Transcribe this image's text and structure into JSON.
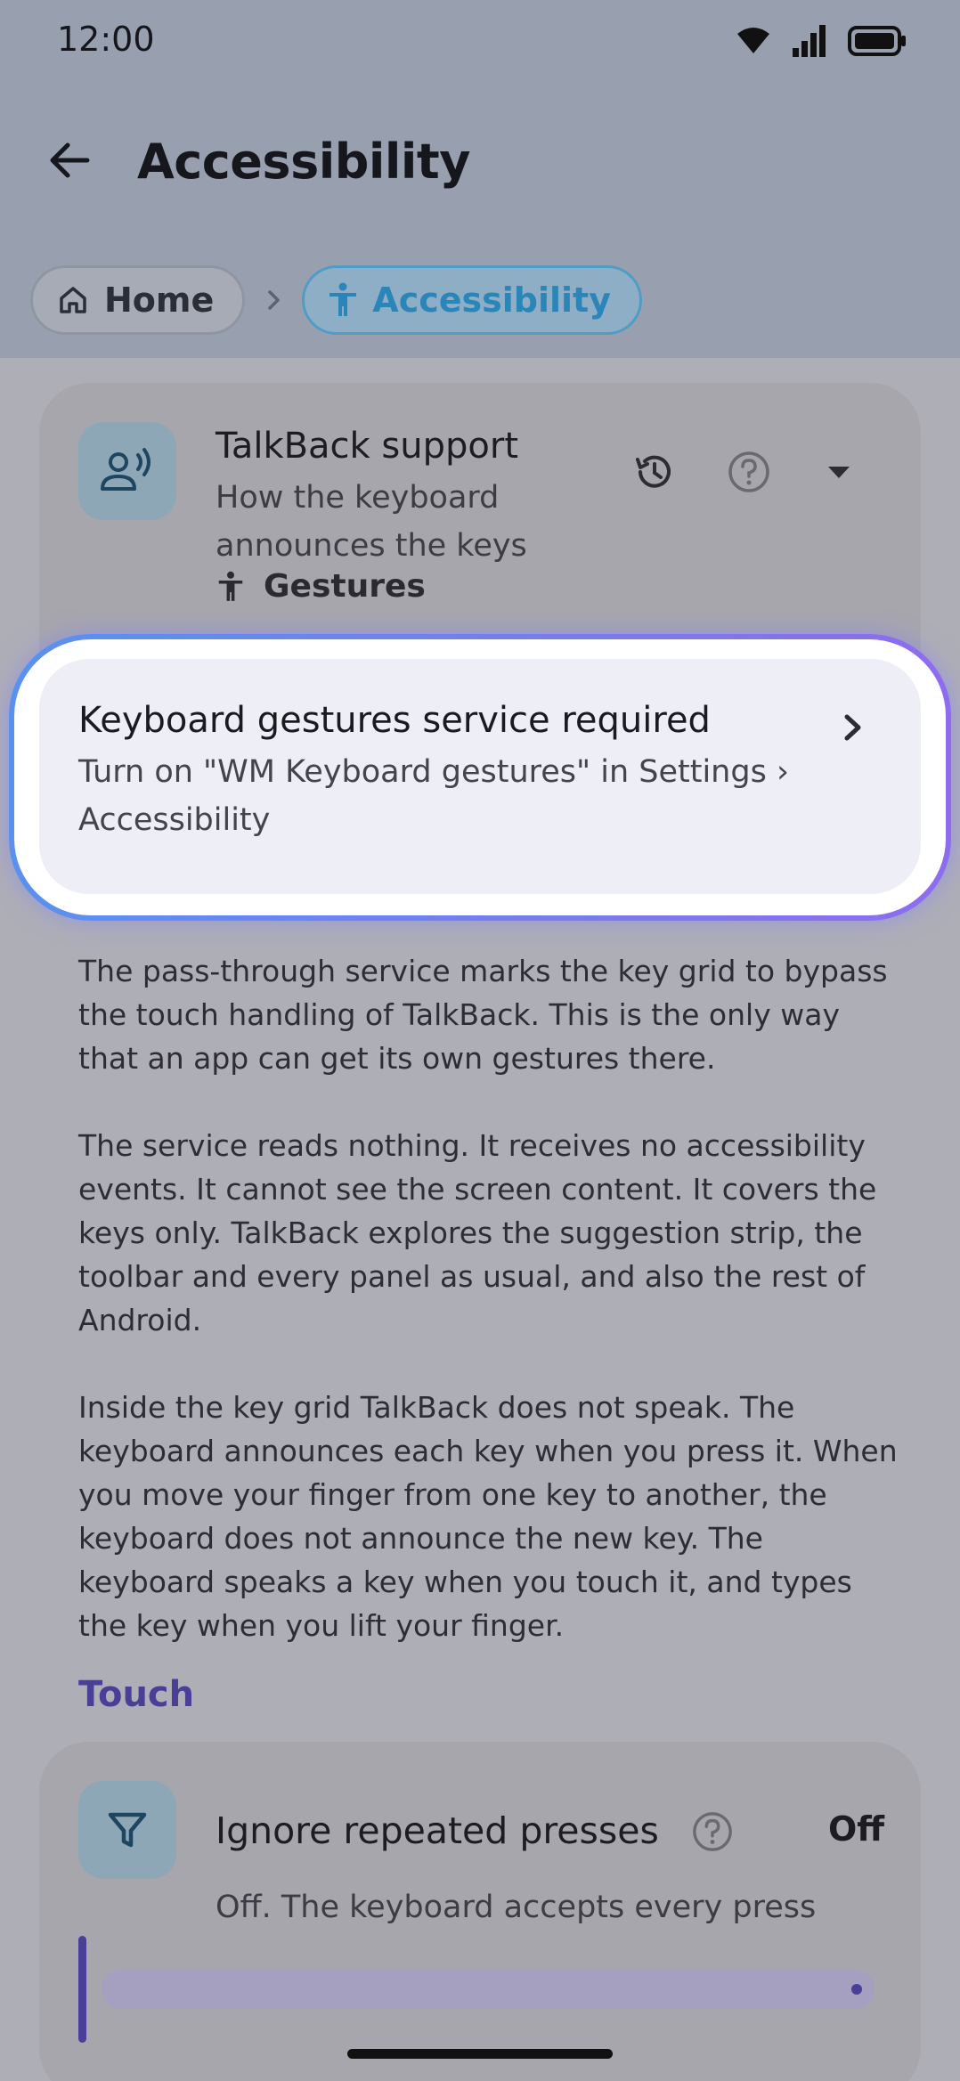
{
  "status_bar": {
    "time": "12:00"
  },
  "app_bar": {
    "title": "Accessibility"
  },
  "breadcrumb": {
    "home": "Home",
    "current": "Accessibility"
  },
  "talkback_card": {
    "title": "TalkBack support",
    "description": "How the keyboard announces the keys",
    "tag": "Gestures"
  },
  "service_banner": {
    "title": "Keyboard gestures service required",
    "description": "Turn on \"WM Keyboard gestures\" in Settings › Accessibility"
  },
  "paragraphs": [
    "The pass-through service marks the key grid to bypass the touch handling of TalkBack. This is the only way that an app can get its own gestures there.",
    "The service reads nothing. It receives no accessibility events. It cannot see the screen content. It covers the keys only. TalkBack explores the suggestion strip, the toolbar and every panel as usual, and also the rest of Android.",
    "Inside the key grid TalkBack does not speak. The keyboard announces each key when you press it. When you move your finger from one key to another, the keyboard does not announce the new key. The keyboard speaks a key when you touch it, and types the key when you lift your finger."
  ],
  "section_touch": {
    "label": "Touch"
  },
  "ignore_repeated": {
    "title": "Ignore repeated presses",
    "value": "Off",
    "description": "Off. The keyboard accepts every press",
    "slider_fraction": 1.0
  },
  "colors": {
    "accent": "#4a3f96",
    "breadcrumb_active": "#2a86b8",
    "highlight_gradient_start": "#5a91f0",
    "highlight_gradient_end": "#8e6cf0"
  }
}
